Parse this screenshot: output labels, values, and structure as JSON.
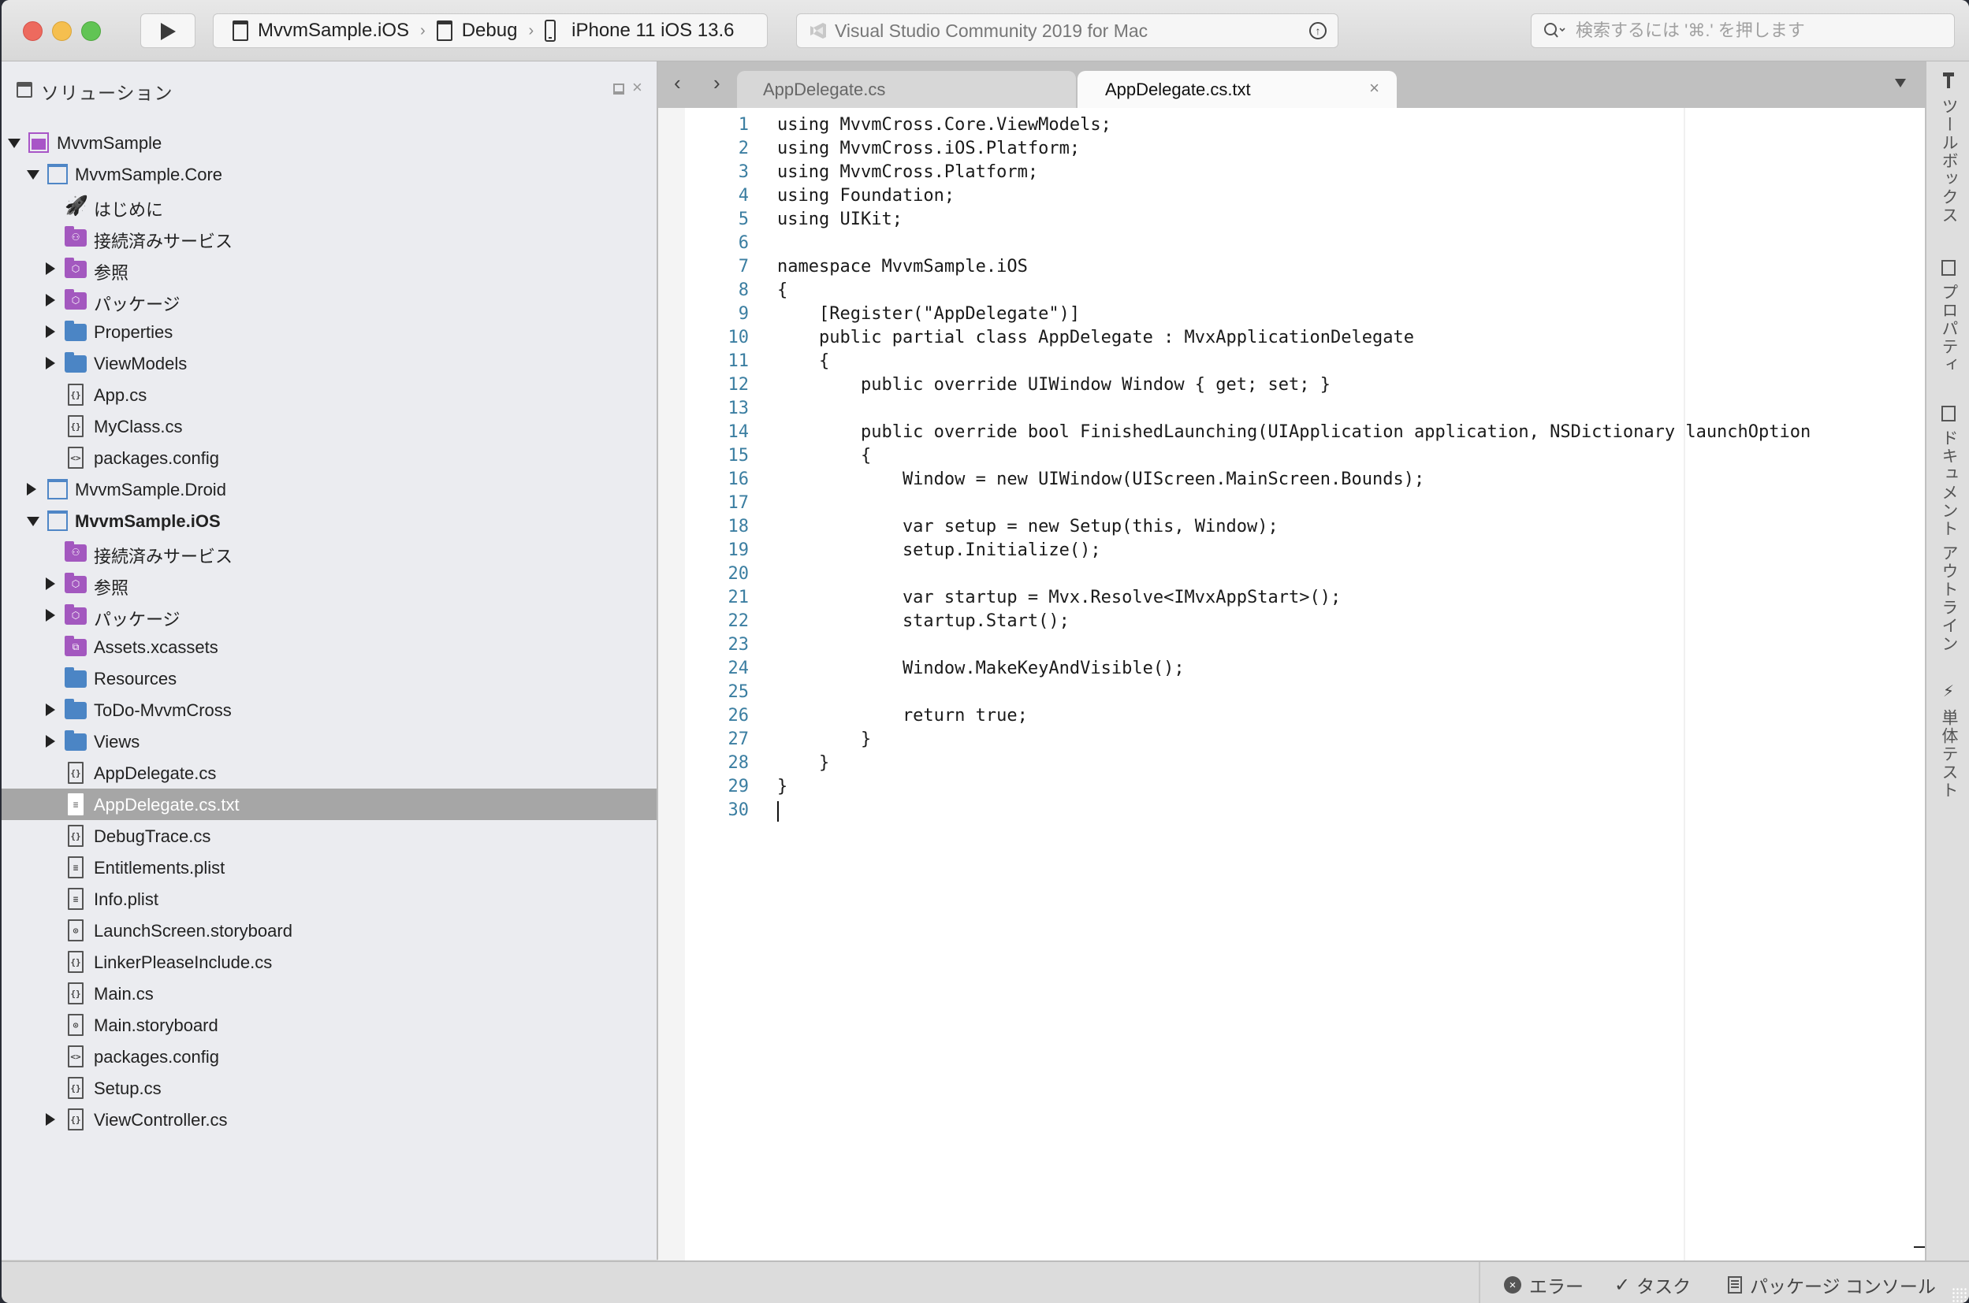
{
  "toolbar": {
    "config": {
      "project": "MvvmSample.iOS",
      "configuration": "Debug",
      "device": "iPhone 11 iOS 13.6",
      "separator": "›"
    },
    "status_text": "Visual Studio Community 2019 for Mac",
    "search_placeholder": "検索するには '⌘.' を押します"
  },
  "sidebar": {
    "title": "ソリューション",
    "tree": [
      {
        "label": "MvvmSample",
        "icon": "solution",
        "depth": 0,
        "disclosure": "open"
      },
      {
        "label": "MvvmSample.Core",
        "icon": "project",
        "depth": 1,
        "disclosure": "open"
      },
      {
        "label": "はじめに",
        "icon": "rocket",
        "depth": 2,
        "disclosure": "none"
      },
      {
        "label": "接続済みサービス",
        "icon": "folder-purple-services",
        "depth": 2,
        "disclosure": "none"
      },
      {
        "label": "参照",
        "icon": "folder-purple-refs",
        "depth": 2,
        "disclosure": "closed"
      },
      {
        "label": "パッケージ",
        "icon": "folder-purple-refs",
        "depth": 2,
        "disclosure": "closed"
      },
      {
        "label": "Properties",
        "icon": "folder-blue",
        "depth": 2,
        "disclosure": "closed"
      },
      {
        "label": "ViewModels",
        "icon": "folder-blue",
        "depth": 2,
        "disclosure": "closed"
      },
      {
        "label": "App.cs",
        "icon": "file-cs",
        "depth": 2,
        "disclosure": "none"
      },
      {
        "label": "MyClass.cs",
        "icon": "file-cs",
        "depth": 2,
        "disclosure": "none"
      },
      {
        "label": "packages.config",
        "icon": "file-xml",
        "depth": 2,
        "disclosure": "none"
      },
      {
        "label": "MvvmSample.Droid",
        "icon": "project",
        "depth": 1,
        "disclosure": "closed"
      },
      {
        "label": "MvvmSample.iOS",
        "icon": "project",
        "depth": 1,
        "disclosure": "open",
        "bold": true
      },
      {
        "label": "接続済みサービス",
        "icon": "folder-purple-services",
        "depth": 2,
        "disclosure": "none"
      },
      {
        "label": "参照",
        "icon": "folder-purple-refs",
        "depth": 2,
        "disclosure": "closed"
      },
      {
        "label": "パッケージ",
        "icon": "folder-purple-refs",
        "depth": 2,
        "disclosure": "closed"
      },
      {
        "label": "Assets.xcassets",
        "icon": "folder-purple-assets",
        "depth": 2,
        "disclosure": "none"
      },
      {
        "label": "Resources",
        "icon": "folder-blue",
        "depth": 2,
        "disclosure": "none"
      },
      {
        "label": "ToDo-MvvmCross",
        "icon": "folder-blue",
        "depth": 2,
        "disclosure": "closed"
      },
      {
        "label": "Views",
        "icon": "folder-blue",
        "depth": 2,
        "disclosure": "closed"
      },
      {
        "label": "AppDelegate.cs",
        "icon": "file-cs",
        "depth": 2,
        "disclosure": "none"
      },
      {
        "label": "AppDelegate.cs.txt",
        "icon": "file-txt",
        "depth": 2,
        "disclosure": "none",
        "selected": true
      },
      {
        "label": "DebugTrace.cs",
        "icon": "file-cs",
        "depth": 2,
        "disclosure": "none"
      },
      {
        "label": "Entitlements.plist",
        "icon": "file-plist",
        "depth": 2,
        "disclosure": "none"
      },
      {
        "label": "Info.plist",
        "icon": "file-plist",
        "depth": 2,
        "disclosure": "none"
      },
      {
        "label": "LaunchScreen.storyboard",
        "icon": "file-storyboard",
        "depth": 2,
        "disclosure": "none"
      },
      {
        "label": "LinkerPleaseInclude.cs",
        "icon": "file-cs",
        "depth": 2,
        "disclosure": "none"
      },
      {
        "label": "Main.cs",
        "icon": "file-cs",
        "depth": 2,
        "disclosure": "none"
      },
      {
        "label": "Main.storyboard",
        "icon": "file-storyboard",
        "depth": 2,
        "disclosure": "none"
      },
      {
        "label": "packages.config",
        "icon": "file-xml",
        "depth": 2,
        "disclosure": "none"
      },
      {
        "label": "Setup.cs",
        "icon": "file-cs",
        "depth": 2,
        "disclosure": "none"
      },
      {
        "label": "ViewController.cs",
        "icon": "file-cs",
        "depth": 2,
        "disclosure": "closed"
      }
    ]
  },
  "editor": {
    "tabs": [
      {
        "label": "AppDelegate.cs",
        "active": false
      },
      {
        "label": "AppDelegate.cs.txt",
        "active": true
      }
    ],
    "caret_line": 30,
    "lines": [
      "using MvvmCross.Core.ViewModels;",
      "using MvvmCross.iOS.Platform;",
      "using MvvmCross.Platform;",
      "using Foundation;",
      "using UIKit;",
      "",
      "namespace MvvmSample.iOS",
      "{",
      "    [Register(\"AppDelegate\")]",
      "    public partial class AppDelegate : MvxApplicationDelegate",
      "    {",
      "        public override UIWindow Window { get; set; }",
      "",
      "        public override bool FinishedLaunching(UIApplication application, NSDictionary launchOption",
      "        {",
      "            Window = new UIWindow(UIScreen.MainScreen.Bounds);",
      "",
      "            var setup = new Setup(this, Window);",
      "            setup.Initialize();",
      "",
      "            var startup = Mvx.Resolve<IMvxAppStart>();",
      "            startup.Start();",
      "",
      "            Window.MakeKeyAndVisible();",
      "",
      "            return true;",
      "        }",
      "    }",
      "}",
      ""
    ]
  },
  "right_pads": [
    {
      "label": "ツールボックス",
      "icon": "hammer"
    },
    {
      "label": "プロパティ",
      "icon": "properties"
    },
    {
      "label": "ドキュメント アウトライン",
      "icon": "outline"
    },
    {
      "label": "単体テスト",
      "icon": "lightning"
    }
  ],
  "bottombar": {
    "errors_label": "エラー",
    "tasks_label": "タスク",
    "package_console_label": "パッケージ コンソール"
  },
  "colors": {
    "line_number": "#3b7ea1",
    "selection_bg": "#a6a6a6",
    "folder_blue": "#4b85c5",
    "folder_purple": "#a358bf",
    "solution_purple": "#a855c7"
  }
}
